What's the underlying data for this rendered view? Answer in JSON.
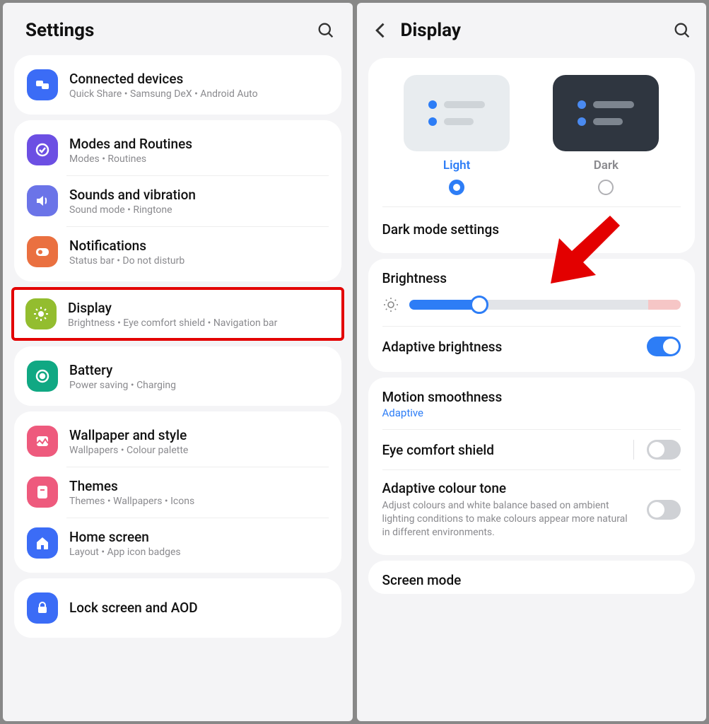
{
  "left": {
    "title": "Settings",
    "items": [
      {
        "title": "Connected devices",
        "sub": "Quick Share  •  Samsung DeX  •  Android Auto",
        "icon": "connected",
        "color": "#3b6cf6"
      },
      {
        "title": "Modes and Routines",
        "sub": "Modes  •  Routines",
        "icon": "modes",
        "color": "#6c4fe3"
      },
      {
        "title": "Sounds and vibration",
        "sub": "Sound mode  •  Ringtone",
        "icon": "sound",
        "color": "#6b74e8"
      },
      {
        "title": "Notifications",
        "sub": "Status bar  •  Do not disturb",
        "icon": "notif",
        "color": "#ea7040"
      },
      {
        "title": "Display",
        "sub": "Brightness  •  Eye comfort shield  •  Navigation bar",
        "icon": "display",
        "color": "#93bd2f"
      },
      {
        "title": "Battery",
        "sub": "Power saving  •  Charging",
        "icon": "battery",
        "color": "#10a883"
      },
      {
        "title": "Wallpaper and style",
        "sub": "Wallpapers  •  Colour palette",
        "icon": "wallpaper",
        "color": "#ee5a7d"
      },
      {
        "title": "Themes",
        "sub": "Themes  •  Wallpapers  •  Icons",
        "icon": "themes",
        "color": "#ee5a7d"
      },
      {
        "title": "Home screen",
        "sub": "Layout  •  App icon badges",
        "icon": "home",
        "color": "#3b6cf6"
      },
      {
        "title": "Lock screen and AOD",
        "sub": "",
        "icon": "lock",
        "color": "#3b6cf6"
      }
    ]
  },
  "right": {
    "title": "Display",
    "theme": {
      "light": "Light",
      "dark": "Dark",
      "selected": "light"
    },
    "dark_mode_settings": "Dark mode settings",
    "brightness_label": "Brightness",
    "adaptive_brightness": "Adaptive brightness",
    "motion": {
      "title": "Motion smoothness",
      "value": "Adaptive"
    },
    "eye_comfort": "Eye comfort shield",
    "adaptive_colour": {
      "title": "Adaptive colour tone",
      "desc": "Adjust colours and white balance based on ambient lighting conditions to make colours appear more natural in different environments."
    },
    "screen_mode": "Screen mode"
  }
}
